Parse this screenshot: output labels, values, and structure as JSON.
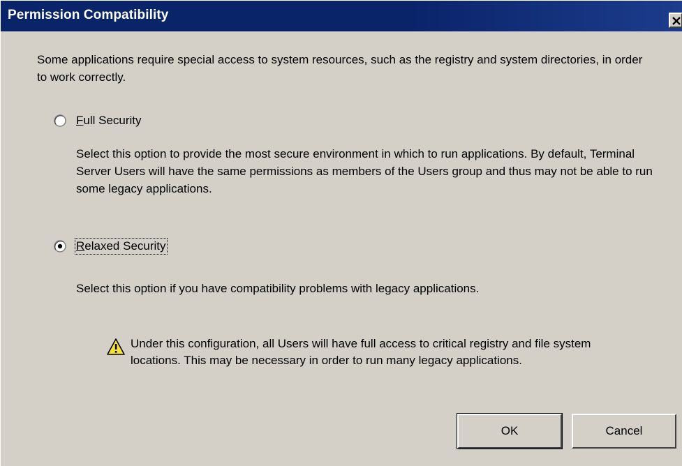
{
  "window": {
    "title": "Permission Compatibility",
    "close_icon": "close-icon"
  },
  "intro_text": "Some applications require special access to system resources, such as the registry and system directories, in order to work correctly.",
  "options": [
    {
      "label_mnemonic": "F",
      "label_rest": "ull Security",
      "selected": false,
      "description": "Select this option to provide the most secure environment in which to run applications.  By default, Terminal Server Users will have the same permissions as members of the Users group and thus may not be able to run some legacy applications."
    },
    {
      "label_mnemonic": "R",
      "label_rest": "elaxed Security",
      "selected": true,
      "description": "Select this option if you have compatibility problems with legacy applications."
    }
  ],
  "warning": {
    "icon": "warning-icon",
    "text": "Under this configuration, all Users will have full access to critical registry and file system locations. This may be necessary in order to run many legacy applications."
  },
  "buttons": {
    "ok_label": "OK",
    "cancel_label": "Cancel"
  },
  "colors": {
    "titlebar": "#0a246a",
    "face": "#d4d0c8",
    "warning_yellow": "#f5e33a"
  }
}
